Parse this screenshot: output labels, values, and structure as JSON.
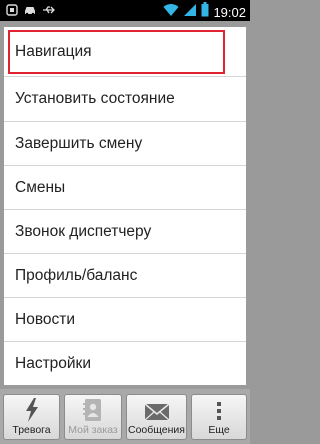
{
  "status_bar": {
    "time": "19:02",
    "icons": [
      "notification-icon",
      "car-icon",
      "usb-icon",
      "wifi-icon",
      "signal-icon",
      "battery-icon"
    ]
  },
  "menu": {
    "items": [
      {
        "label": "Навигация",
        "selected": true
      },
      {
        "label": "Установить состояние"
      },
      {
        "label": "Завершить смену"
      },
      {
        "label": "Смены"
      },
      {
        "label": "Звонок диспетчеру"
      },
      {
        "label": "Профиль/баланс"
      },
      {
        "label": "Новости"
      },
      {
        "label": "Настройки"
      }
    ]
  },
  "bottom_bar": {
    "buttons": [
      {
        "label": "Тревога",
        "icon": "lightning-icon",
        "enabled": true
      },
      {
        "label": "Мой заказ",
        "icon": "contact-card-icon",
        "enabled": false
      },
      {
        "label": "Сообщения",
        "icon": "envelope-icon",
        "enabled": true
      },
      {
        "label": "Еще",
        "icon": "more-icon",
        "enabled": true
      }
    ]
  },
  "colors": {
    "selection_outline": "#e0232f",
    "accent_status": "#33b5e5"
  }
}
